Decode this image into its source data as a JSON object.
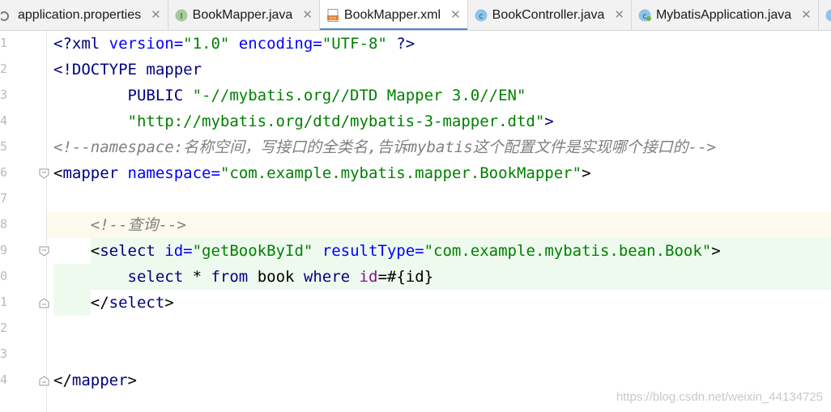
{
  "tabs": [
    {
      "label": "application.properties",
      "icon": "properties-file-icon",
      "active": false
    },
    {
      "label": "BookMapper.java",
      "icon": "interface-icon",
      "active": false
    },
    {
      "label": "BookMapper.xml",
      "icon": "xml-file-icon",
      "active": true
    },
    {
      "label": "BookController.java",
      "icon": "class-icon",
      "active": false
    },
    {
      "label": "MybatisApplication.java",
      "icon": "spring-class-icon",
      "active": false
    }
  ],
  "close_glyph": "✕",
  "line_numbers": [
    "1",
    "2",
    "3",
    "4",
    "5",
    "6",
    "7",
    "8",
    "9",
    "0",
    "1",
    "2",
    "3",
    "4"
  ],
  "code": {
    "l1": {
      "a": "<?xml ",
      "b": "version=",
      "c": "\"1.0\"",
      "d": " encoding=",
      "e": "\"UTF-8\"",
      "f": " ?>"
    },
    "l2": {
      "a": "<!DOCTYPE mapper"
    },
    "l3": {
      "a": "        PUBLIC ",
      "b": "\"-//mybatis.org//DTD Mapper 3.0//EN\""
    },
    "l4": {
      "a": "        ",
      "b": "\"http://mybatis.org/dtd/mybatis-3-mapper.dtd\"",
      "c": ">"
    },
    "l5": {
      "a": "<!--namespace:名称空间，写接口的全类名,告诉mybatis这个配置文件是实现哪个接口的-->"
    },
    "l6": {
      "a": "<",
      "b": "mapper",
      "c": " namespace=",
      "d": "\"com.example.mybatis.mapper.BookMapper\"",
      "e": ">"
    },
    "l8": {
      "a": "    ",
      "b": "<!--查询-->"
    },
    "l9": {
      "a": "    <",
      "b": "select",
      "c": " id=",
      "d": "\"getBookById\"",
      "e": " resultType=",
      "f": "\"com.example.mybatis.bean.Book\"",
      "g": ">"
    },
    "l10": {
      "a": "        ",
      "b": "select",
      "c": " * ",
      "d": "from",
      "e": " book ",
      "f": "where",
      "g": " ",
      "h": "id",
      "i": "=#{id}"
    },
    "l11": {
      "a": "    </",
      "b": "select",
      "c": ">"
    },
    "l14": {
      "a": "</",
      "b": "mapper",
      "c": ">"
    }
  },
  "watermark": "https://blog.csdn.net/weixin_44134725"
}
